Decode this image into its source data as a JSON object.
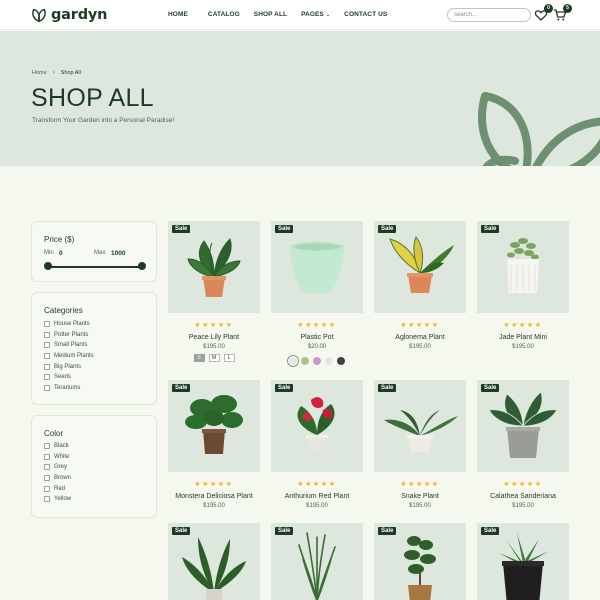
{
  "brand": {
    "name": "gardyn"
  },
  "nav": {
    "items": [
      {
        "label": "HOME"
      },
      {
        "label": "CATALOG"
      },
      {
        "label": "SHOP ALL"
      },
      {
        "label": "PAGES",
        "has_dropdown": true
      },
      {
        "label": "CONTACT US"
      }
    ]
  },
  "header": {
    "search_placeholder": "search...",
    "wishlist_count": "0",
    "cart_count": "5"
  },
  "hero": {
    "breadcrumb": [
      "Home",
      "Shop All"
    ],
    "title": "SHOP ALL",
    "subtitle": "Transform Your Garden into a Personal Paradise!"
  },
  "filters": {
    "price": {
      "title": "Price ($)",
      "min_label": "Min",
      "min_value": "0",
      "max_label": "Max",
      "max_value": "1000"
    },
    "categories": {
      "title": "Categories",
      "items": [
        "House Plants",
        "Potter Plants",
        "Small Plants",
        "Medium Plants",
        "Big Plants",
        "Seeds",
        "Terariums"
      ]
    },
    "color": {
      "title": "Color",
      "items": [
        "Black",
        "White",
        "Grey",
        "Brown",
        "Red",
        "Yellow"
      ]
    }
  },
  "products": [
    {
      "name": "Peace Lily Plant",
      "price": "$195.00",
      "sale_label": "Sale",
      "stars": "★★★★★",
      "sizes": [
        "S",
        "M",
        "L"
      ],
      "active_size": "S"
    },
    {
      "name": "Plastic Pot",
      "price": "$20.00",
      "sale_label": "Sale",
      "stars": "★★★★★",
      "swatches": [
        "#e3e8e1",
        "#a9c48b",
        "#c79ac8",
        "#e9e4ea",
        "#3f403f"
      ]
    },
    {
      "name": "Aglonema Plant",
      "price": "$195.00",
      "sale_label": "Sale",
      "stars": "★★★★★"
    },
    {
      "name": "Jade Plant Mini",
      "price": "$195.00",
      "sale_label": "Sale",
      "stars": "★★★★★"
    },
    {
      "name": "Monstera Deliciosa Plant",
      "price": "$195.00",
      "sale_label": "Sale",
      "stars": "★★★★★"
    },
    {
      "name": "Anthurium Red Plant",
      "price": "$195.00",
      "sale_label": "Sale",
      "stars": "★★★★★"
    },
    {
      "name": "Snake Plant",
      "price": "$195.00",
      "sale_label": "Sale",
      "stars": "★★★★★"
    },
    {
      "name": "Calathea Sanderiana",
      "price": "$195.00",
      "sale_label": "Sale",
      "stars": "★★★★★"
    },
    {
      "name": "",
      "price": "",
      "sale_label": "Sale",
      "stars": ""
    },
    {
      "name": "",
      "price": "",
      "sale_label": "Sale",
      "stars": ""
    },
    {
      "name": "",
      "price": "",
      "sale_label": "Sale",
      "stars": ""
    },
    {
      "name": "",
      "price": "",
      "sale_label": "Sale",
      "stars": ""
    }
  ],
  "colors": {
    "brand_dark": "#1e3a24",
    "hero_bg": "#dde7dd",
    "page_bg": "#f4f8ef",
    "star": "#f0b81c"
  }
}
